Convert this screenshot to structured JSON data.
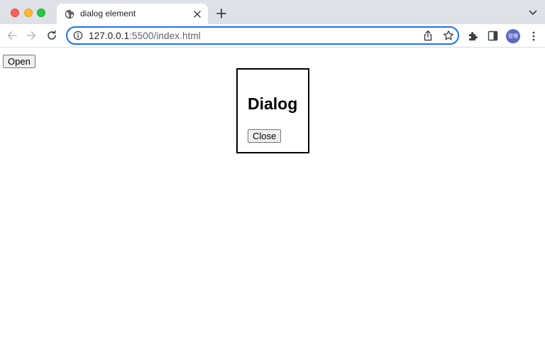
{
  "browser": {
    "tab": {
      "title": "dialog element",
      "favicon": "globe-icon"
    },
    "address_bar": {
      "host": "127.0.0.1",
      "path": ":5500/index.html"
    },
    "avatar_text": "管理",
    "accent_color": "#1a73e8"
  },
  "page": {
    "open_button_label": "Open",
    "dialog": {
      "heading": "Dialog",
      "close_button_label": "Close"
    }
  }
}
